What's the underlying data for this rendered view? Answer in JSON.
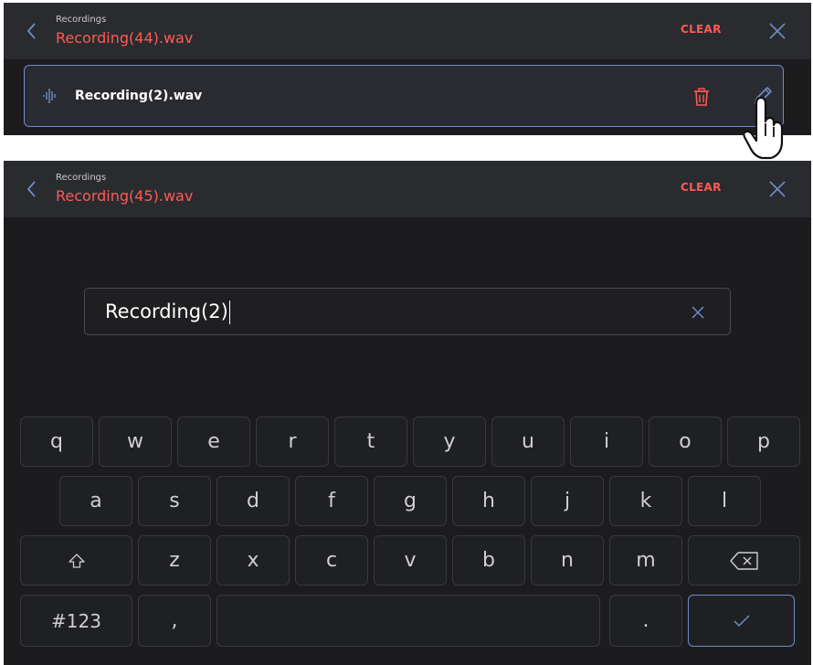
{
  "screen1": {
    "header": {
      "breadcrumb": "Recordings",
      "title": "Recording(44).wav",
      "clear_label": "CLEAR"
    },
    "recording": {
      "name": "Recording(2).wav"
    }
  },
  "screen2": {
    "header": {
      "breadcrumb": "Recordings",
      "title": "Recording(45).wav",
      "clear_label": "CLEAR"
    },
    "rename_input": {
      "value": "Recording(2)"
    }
  },
  "keyboard": {
    "row1": [
      "q",
      "w",
      "e",
      "r",
      "t",
      "y",
      "u",
      "i",
      "o",
      "p"
    ],
    "row2": [
      "a",
      "s",
      "d",
      "f",
      "g",
      "h",
      "j",
      "k",
      "l"
    ],
    "row3": [
      "z",
      "x",
      "c",
      "v",
      "b",
      "n",
      "m"
    ],
    "numbers_key": "#123",
    "comma_key": ",",
    "period_key": "."
  },
  "colors": {
    "accent": "#ff5a55",
    "highlight": "#6f8cc8",
    "background": "#1c1c1f",
    "header": "#2a2b2f"
  }
}
